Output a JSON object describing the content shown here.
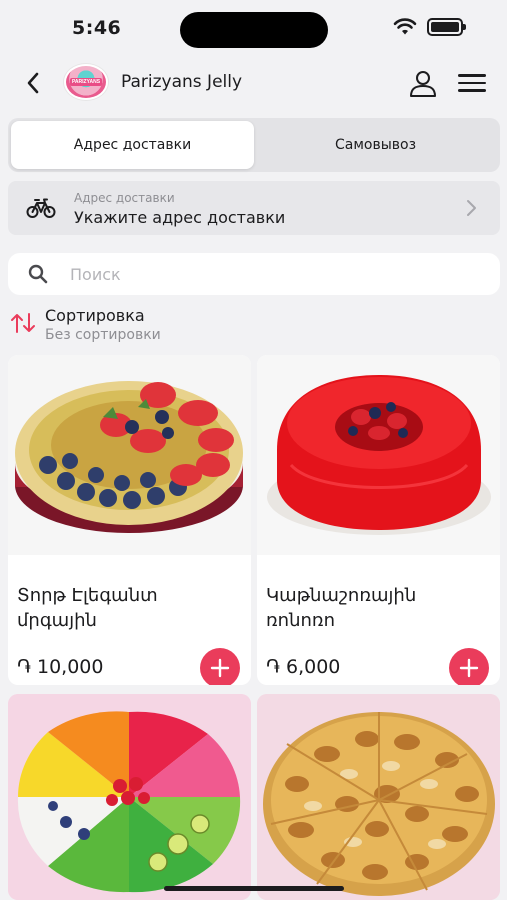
{
  "status_bar": {
    "time": "5:46"
  },
  "header": {
    "store_name": "Parizyans Jelly",
    "logo_text": "PARIZYANS"
  },
  "delivery_tabs": [
    {
      "label": "Адрес доставки",
      "active": true
    },
    {
      "label": "Самовывоз",
      "active": false
    }
  ],
  "address": {
    "label": "Адрес доставки",
    "value": "Укажите адрес доставки"
  },
  "search": {
    "placeholder": "Поиск"
  },
  "sort": {
    "title": "Сортировка",
    "subtitle": "Без сортировки"
  },
  "products": [
    {
      "name": "Տորթ Էլեգանտ մրգային",
      "price": "֏ 10,000"
    },
    {
      "name": "Կաթնաշոռային ռոնոռո",
      "price": "֏ 6,000"
    },
    {
      "name": "",
      "price": ""
    },
    {
      "name": "",
      "price": ""
    }
  ],
  "colors": {
    "accent": "#ea3c5b",
    "background": "#f2f2f4",
    "card": "#ffffff"
  }
}
